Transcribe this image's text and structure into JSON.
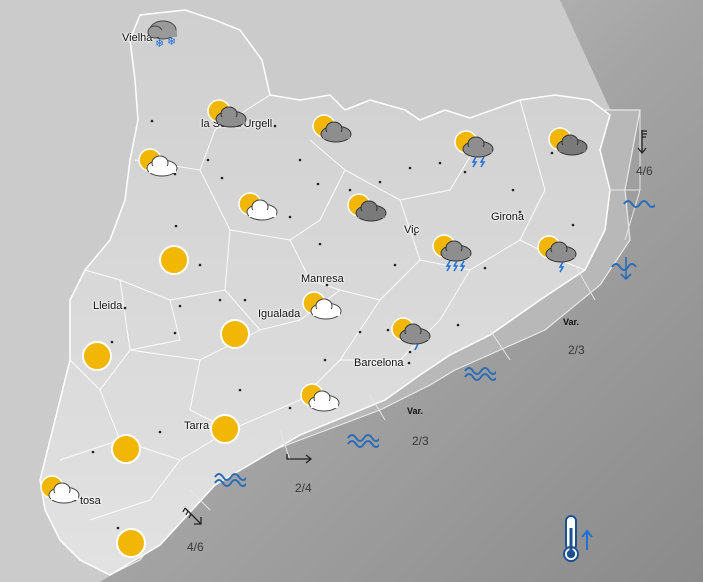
{
  "cities": [
    {
      "id": "vielha",
      "label": "Vielha"
    },
    {
      "id": "seu",
      "label": "la Seu d'Urgell"
    },
    {
      "id": "girona",
      "label": "Girona"
    },
    {
      "id": "vic",
      "label": "Vic"
    },
    {
      "id": "manresa",
      "label": "Manresa"
    },
    {
      "id": "igualada",
      "label": "Igualada"
    },
    {
      "id": "lleida",
      "label": "Lleida"
    },
    {
      "id": "barcelona",
      "label": "Barcelona"
    },
    {
      "id": "tarragona",
      "label": "Tarra"
    },
    {
      "id": "tortosa",
      "label": "tosa"
    }
  ],
  "weather_icons": [
    {
      "type": "snow"
    },
    {
      "type": "partly-cloudy"
    },
    {
      "type": "partly-cloudy"
    },
    {
      "type": "cloudy-thunderstorm"
    },
    {
      "type": "cloudy"
    },
    {
      "type": "partly-cloudy"
    },
    {
      "type": "partly-cloudy"
    },
    {
      "type": "cloudy-thunderstorm"
    },
    {
      "type": "cloudy-thunderstorm"
    },
    {
      "type": "sunny"
    },
    {
      "type": "partly-cloudy"
    },
    {
      "type": "sunny"
    },
    {
      "type": "cloudy-rain"
    },
    {
      "type": "sunny"
    },
    {
      "type": "partly-cloudy"
    },
    {
      "type": "sunny"
    },
    {
      "type": "sunny"
    },
    {
      "type": "partly-cloudy"
    },
    {
      "type": "sunny"
    }
  ],
  "sea": {
    "wind_labels": [
      "Var.",
      "Var."
    ],
    "values": [
      "4/6",
      "2/3",
      "2/3",
      "2/4",
      "4/6"
    ],
    "wave_icons": [
      "waves-icon",
      "waves-icon",
      "waves-icon",
      "waves-icon",
      "swell-icon"
    ]
  },
  "temperature_trend": "rising",
  "colors": {
    "sea": "#8c8c8c",
    "land": "#d4d4d4",
    "sun": "#f2b705",
    "wave": "#2a6db6"
  }
}
